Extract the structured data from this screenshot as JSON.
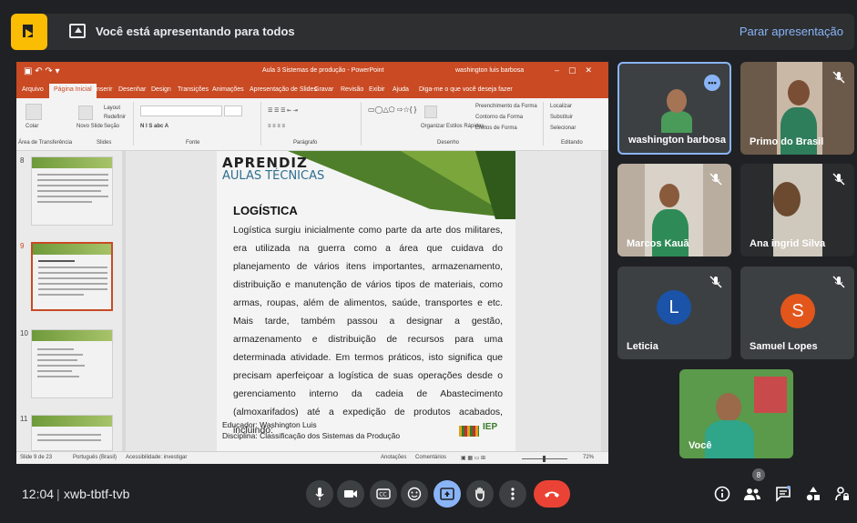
{
  "banner": {
    "text": "Você está apresentando para todos",
    "stop_link": "Parar apresentação"
  },
  "presentation": {
    "doc_title": "Aula 3 Sistemas de produção - PowerPoint",
    "user": "washington luis barbosa",
    "tabs": [
      "Arquivo",
      "Página Inicial",
      "Inserir",
      "Desenhar",
      "Design",
      "Transições",
      "Animações",
      "Apresentação de Slides",
      "Gravar",
      "Revisão",
      "Exibir",
      "Ajuda"
    ],
    "tell_me": "Diga-me o que você deseja fazer",
    "ribbon": {
      "paste": "Colar",
      "new_slide": "Novo Slide",
      "layout": "Layout",
      "reset": "Redefinir",
      "section": "Seção",
      "organize": "Organizar",
      "quick_styles": "Estilos Rápidos",
      "shape_fill": "Preenchimento da Forma",
      "shape_outline": "Contorno da Forma",
      "shape_effects": "Efeitos de Forma",
      "find": "Localizar",
      "replace": "Substituir",
      "select": "Selecionar",
      "groups": [
        "Área de Transferência",
        "Slides",
        "Fonte",
        "Parágrafo",
        "Desenho",
        "Editando"
      ]
    },
    "thumb_numbers": [
      "8",
      "9",
      "10",
      "11"
    ],
    "slide": {
      "brand_line1": "APRENDIZ",
      "brand_line2": "AULAS TÉCNICAS",
      "heading": "LOGÍSTICA",
      "body": "Logística surgiu inicialmente como parte da arte dos militares, era utilizada na guerra como a área que cuidava do planejamento de vários itens importantes, armazenamento, distribuição e manutenção de vários tipos de materiais, como armas, roupas, além de alimentos, saúde, transportes e etc. Mais tarde, também passou a designar a gestão, armazenamento e distribuição de recursos para uma determinada atividade. Em termos práticos, isto significa que precisam aperfeiçoar a logística de suas operações desde o gerenciamento interno da cadeia de Abastecimento (almoxarifados) até a expedição de produtos acabados, incluindo:",
      "footer_line1": "Educador: Washington Luis",
      "footer_line2": "Disciplina: Classificação dos Sistemas da Produção",
      "logo_text": "IEP"
    },
    "status": {
      "slide_count": "Slide 9 de 23",
      "language": "Português (Brasil)",
      "accessibility": "Acessibilidade: investigar",
      "notes": "Anotações",
      "comments": "Comentários",
      "zoom": "72%"
    }
  },
  "participants": [
    {
      "name": "washington barbosa"
    },
    {
      "name": "Primo do Brasil"
    },
    {
      "name": "Marcos Kauã"
    },
    {
      "name": "Ana ingrid Silva"
    },
    {
      "name": "Leticia",
      "initial": "L"
    },
    {
      "name": "Samuel Lopes",
      "initial": "S"
    },
    {
      "name": "Você"
    }
  ],
  "bottom": {
    "time": "12:04",
    "meeting_code": "xwb-tbtf-tvb",
    "people_count": "8"
  },
  "colors": {
    "meet_bg": "#202124",
    "accent": "#8ab4f8",
    "hangup": "#ea4335",
    "ppt_orange": "#c94a23",
    "leticia": "#1a53a8",
    "samuel": "#e2561b"
  }
}
